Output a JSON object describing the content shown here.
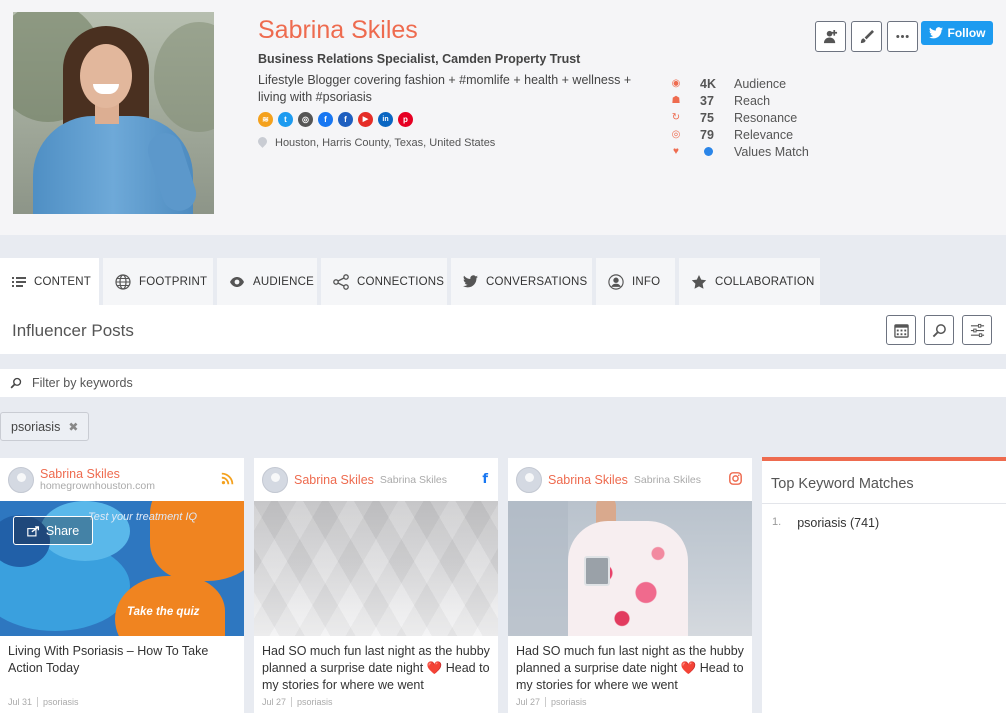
{
  "profile": {
    "name": "Sabrina Skiles",
    "title": "Business Relations Specialist, Camden Property Trust",
    "bio": "Lifestyle Blogger covering fashion + #momlife + health + wellness + living with #psoriasis",
    "location": "Houston, Harris County, Texas, United States",
    "socials": [
      {
        "icon": "rss-icon",
        "color": "#f4a11d",
        "glyph": "≋"
      },
      {
        "icon": "twitter-icon",
        "color": "#1d9bf0",
        "glyph": "t"
      },
      {
        "icon": "instagram-icon",
        "color": "#555555",
        "glyph": "◎"
      },
      {
        "icon": "facebook-icon",
        "color": "#1877f2",
        "glyph": "f"
      },
      {
        "icon": "facebook-page-icon",
        "color": "#1f5fbf",
        "glyph": "f"
      },
      {
        "icon": "youtube-icon",
        "color": "#e52d27",
        "glyph": "▶"
      },
      {
        "icon": "linkedin-icon",
        "color": "#0a66c2",
        "glyph": "in"
      },
      {
        "icon": "pinterest-icon",
        "color": "#e60023",
        "glyph": "p"
      }
    ],
    "metrics": [
      {
        "icon": "eye-icon",
        "glyph": "◉",
        "value": "4K",
        "label": "Audience"
      },
      {
        "icon": "people-icon",
        "glyph": "☗",
        "value": "37",
        "label": "Reach"
      },
      {
        "icon": "refresh-icon",
        "glyph": "↻",
        "value": "75",
        "label": "Resonance"
      },
      {
        "icon": "target-icon",
        "glyph": "◎",
        "value": "79",
        "label": "Relevance"
      },
      {
        "icon": "heart-icon",
        "glyph": "♥",
        "value": "",
        "label": "Values Match",
        "dot_color": "#2a85e8"
      }
    ],
    "follow_label": "Follow"
  },
  "tabs": [
    {
      "label": "CONTENT",
      "icon": "list-icon",
      "active": true
    },
    {
      "label": "FOOTPRINT",
      "icon": "globe-icon",
      "active": false
    },
    {
      "label": "AUDIENCE",
      "icon": "eye-icon",
      "active": false
    },
    {
      "label": "CONNECTIONS",
      "icon": "share-nodes-icon",
      "active": false
    },
    {
      "label": "CONVERSATIONS",
      "icon": "twitter-icon",
      "active": false
    },
    {
      "label": "INFO",
      "icon": "user-circle-icon",
      "active": false
    },
    {
      "label": "COLLABORATION",
      "icon": "star-icon",
      "active": false
    }
  ],
  "posts": {
    "title": "Influencer Posts",
    "filter_placeholder": "Filter by keywords",
    "chip": "psoriasis"
  },
  "cards": [
    {
      "author": "Sabrina Skiles",
      "sub": "homegrownhouston.com",
      "source_icon": "rss-icon",
      "media_text_top": "Test your treatment IQ",
      "media_text_bottom": "Take the quiz",
      "share_label": "Share",
      "text": "Living With Psoriasis – How To Take Action Today",
      "date": "Jul 31",
      "tag": "psoriasis"
    },
    {
      "author": "Sabrina Skiles",
      "sub": "Sabrina Skiles",
      "source_icon": "facebook-icon",
      "text": "Had SO much fun last night as the hubby planned a surprise date night ❤️ Head to my stories for where we went",
      "date": "Jul 27",
      "tag": "psoriasis"
    },
    {
      "author": "Sabrina Skiles",
      "sub": "Sabrina Skiles",
      "source_icon": "instagram-icon",
      "text": "Had SO much fun last night as the hubby planned a surprise date night ❤️ Head to my stories for where we went",
      "date": "Jul 27",
      "tag": "psoriasis"
    }
  ],
  "keywords": {
    "title": "Top Keyword Matches",
    "items": [
      {
        "num": "1.",
        "label": "psoriasis (741)"
      }
    ]
  },
  "colors": {
    "accent": "#ee6b4f",
    "twitter": "#1d9bf0",
    "background": "#e8ebf1"
  }
}
